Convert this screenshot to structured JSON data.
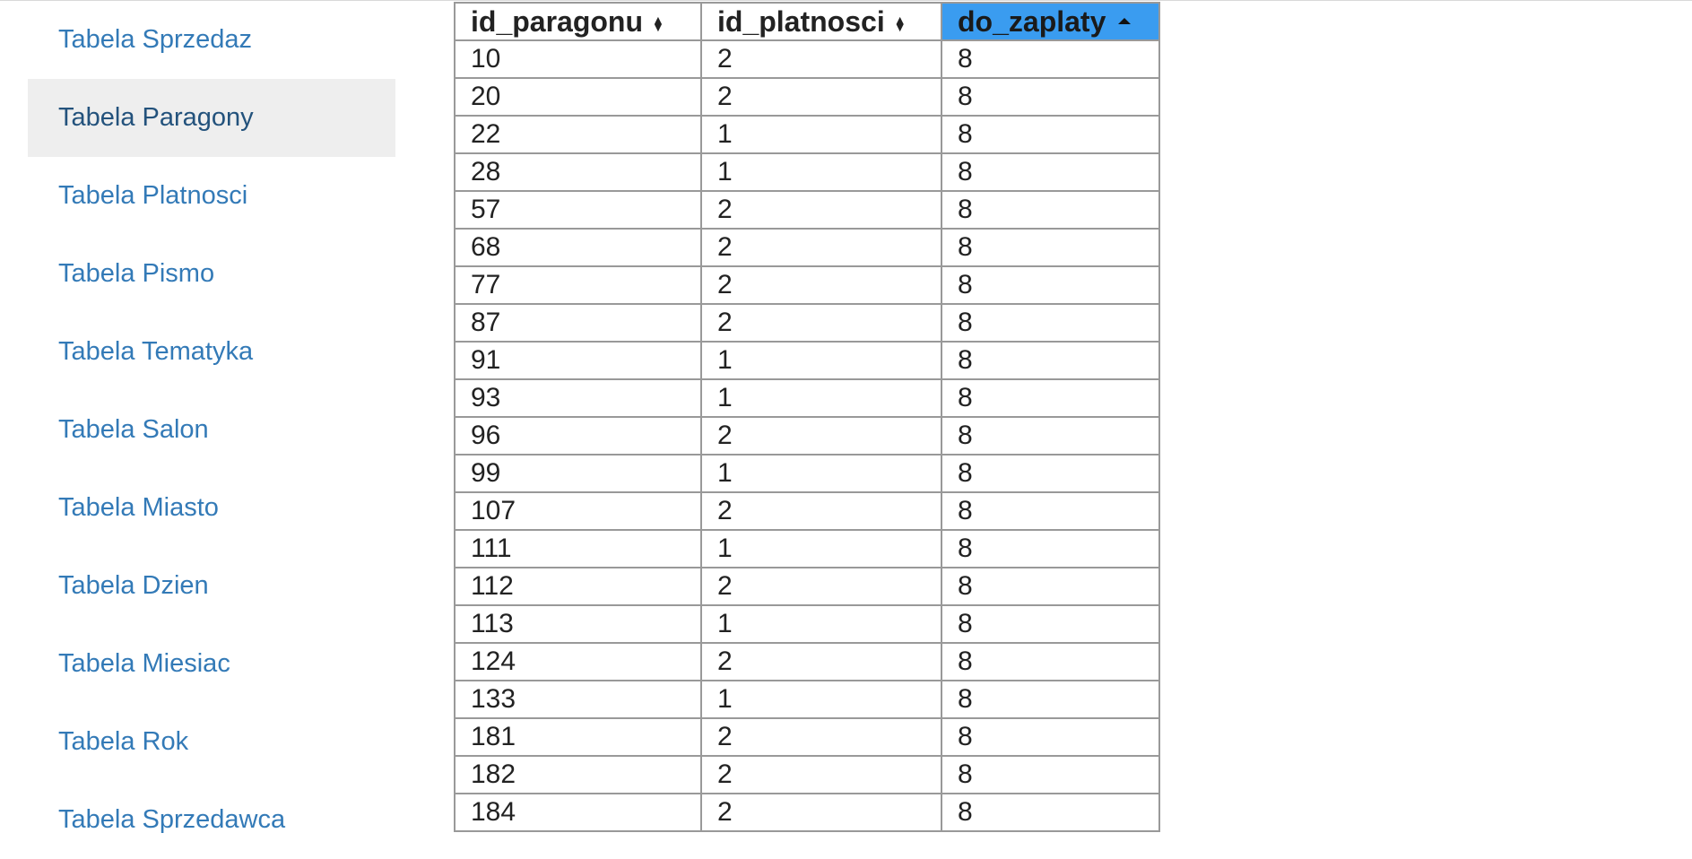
{
  "sidebar": {
    "items": [
      {
        "label": "Tabela Sprzedaz",
        "active": false
      },
      {
        "label": "Tabela Paragony",
        "active": true
      },
      {
        "label": "Tabela Platnosci",
        "active": false
      },
      {
        "label": "Tabela Pismo",
        "active": false
      },
      {
        "label": "Tabela Tematyka",
        "active": false
      },
      {
        "label": "Tabela Salon",
        "active": false
      },
      {
        "label": "Tabela Miasto",
        "active": false
      },
      {
        "label": "Tabela Dzien",
        "active": false
      },
      {
        "label": "Tabela Miesiac",
        "active": false
      },
      {
        "label": "Tabela Rok",
        "active": false
      },
      {
        "label": "Tabela Sprzedawca",
        "active": false
      }
    ]
  },
  "table": {
    "columns": [
      {
        "label": "id_paragonu",
        "sort": "sortable"
      },
      {
        "label": "id_platnosci",
        "sort": "sortable"
      },
      {
        "label": "do_zaplaty",
        "sort": "ascending"
      }
    ],
    "sorted_header_color": "#3a9cf0",
    "rows": [
      [
        "10",
        "2",
        "8"
      ],
      [
        "20",
        "2",
        "8"
      ],
      [
        "22",
        "1",
        "8"
      ],
      [
        "28",
        "1",
        "8"
      ],
      [
        "57",
        "2",
        "8"
      ],
      [
        "68",
        "2",
        "8"
      ],
      [
        "77",
        "2",
        "8"
      ],
      [
        "87",
        "2",
        "8"
      ],
      [
        "91",
        "1",
        "8"
      ],
      [
        "93",
        "1",
        "8"
      ],
      [
        "96",
        "2",
        "8"
      ],
      [
        "99",
        "1",
        "8"
      ],
      [
        "107",
        "2",
        "8"
      ],
      [
        "111",
        "1",
        "8"
      ],
      [
        "112",
        "2",
        "8"
      ],
      [
        "113",
        "1",
        "8"
      ],
      [
        "124",
        "2",
        "8"
      ],
      [
        "133",
        "1",
        "8"
      ],
      [
        "181",
        "2",
        "8"
      ],
      [
        "182",
        "2",
        "8"
      ],
      [
        "184",
        "2",
        "8"
      ]
    ]
  },
  "colors": {
    "link": "#337ab7",
    "active_bg": "#eeeeee",
    "border": "#999999"
  }
}
